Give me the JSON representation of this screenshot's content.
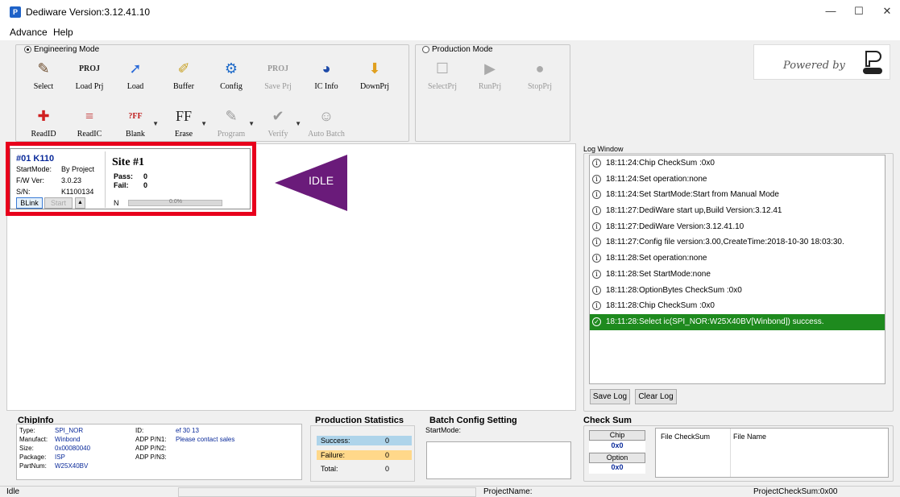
{
  "window": {
    "title": "Dediware Version:3.12.41.10",
    "app_icon": "P",
    "minimize": "—",
    "maximize": "☐",
    "close": "✕"
  },
  "menu": [
    "Advance",
    "Help"
  ],
  "engineering": {
    "label": "Engineering Mode",
    "row1": [
      {
        "label": "Select",
        "icon": "wand-icon",
        "glyph": "✎",
        "color": "#6b4a2a",
        "disabled": false
      },
      {
        "label": "Load Prj",
        "icon": "load-project-icon",
        "glyph": "PROJ",
        "color": "#222",
        "disabled": false
      },
      {
        "label": "Load",
        "icon": "load-icon",
        "glyph": "➚",
        "color": "#2a6ad8",
        "disabled": false
      },
      {
        "label": "Buffer",
        "icon": "buffer-icon",
        "glyph": "✐",
        "color": "#c8a020",
        "disabled": false
      },
      {
        "label": "Config",
        "icon": "gear-icon",
        "glyph": "⚙",
        "color": "#1e6ac8",
        "disabled": false
      },
      {
        "label": "Save Prj",
        "icon": "save-project-icon",
        "glyph": "PROJ",
        "color": "#999",
        "disabled": true
      },
      {
        "label": "IC Info",
        "icon": "ic-info-icon",
        "glyph": "◕",
        "color": "#1e4aa8",
        "disabled": false
      },
      {
        "label": "DownPrj",
        "icon": "download-project-icon",
        "glyph": "⬇",
        "color": "#e0a020",
        "disabled": false
      }
    ],
    "row2": [
      {
        "label": "ReadID",
        "icon": "read-id-icon",
        "glyph": "✚",
        "color": "#d02020",
        "disabled": false,
        "dropdown": false
      },
      {
        "label": "ReadIC",
        "icon": "read-ic-icon",
        "glyph": "≡",
        "color": "#c03030",
        "disabled": false,
        "dropdown": false
      },
      {
        "label": "Blank",
        "icon": "blank-icon",
        "glyph": "?FF",
        "color": "#c02020",
        "disabled": false,
        "dropdown": true
      },
      {
        "label": "Erase",
        "icon": "erase-icon",
        "glyph": "FF",
        "color": "#222",
        "disabled": false,
        "dropdown": true
      },
      {
        "label": "Program",
        "icon": "program-icon",
        "glyph": "✎",
        "color": "#999",
        "disabled": true,
        "dropdown": true
      },
      {
        "label": "Verify",
        "icon": "verify-icon",
        "glyph": "✔",
        "color": "#999",
        "disabled": true,
        "dropdown": true
      },
      {
        "label": "Auto Batch",
        "icon": "auto-batch-icon",
        "glyph": "☺",
        "color": "#999",
        "disabled": true,
        "dropdown": false
      }
    ]
  },
  "production": {
    "label": "Production Mode",
    "buttons": [
      {
        "label": "SelectPrj",
        "icon": "select-project-icon",
        "glyph": "☐"
      },
      {
        "label": "RunPrj",
        "icon": "run-project-icon",
        "glyph": "▶"
      },
      {
        "label": "StopPrj",
        "icon": "stop-project-icon",
        "glyph": "●"
      }
    ]
  },
  "powered_by": "Powered by",
  "site_card": {
    "id": "#01 K110",
    "startmode_label": "StartMode:",
    "startmode": "By Project",
    "fw_label": "F/W Ver:",
    "fw": "3.0.23",
    "sn_label": "S/N:",
    "sn": "K1100134",
    "blink": "BLink",
    "start": "Start",
    "site": "Site #1",
    "pass_label": "Pass:",
    "pass": "0",
    "fail_label": "Fail:",
    "fail": "0",
    "n_label": "N",
    "progress_text": "0.0%",
    "progress": 0,
    "state": "IDLE"
  },
  "log": {
    "title": "Log Window",
    "entries": [
      {
        "text": "18:11:24:Chip CheckSum :0x0",
        "ok": false
      },
      {
        "text": "18:11:24:Set operation:none",
        "ok": false
      },
      {
        "text": "18:11:24:Set StartMode:Start from Manual Mode",
        "ok": false
      },
      {
        "text": "18:11:27:DediWare start up,Build Version:3.12.41",
        "ok": false
      },
      {
        "text": "18:11:27:DediWare Version:3.12.41.10",
        "ok": false
      },
      {
        "text": "18:11:27:Config file version:3.00,CreateTime:2018-10-30 18:03:30.",
        "ok": false
      },
      {
        "text": "18:11:28:Set operation:none",
        "ok": false
      },
      {
        "text": "18:11:28:Set StartMode:none",
        "ok": false
      },
      {
        "text": "18:11:28:OptionBytes CheckSum :0x0",
        "ok": false
      },
      {
        "text": "18:11:28:Chip CheckSum :0x0",
        "ok": false
      },
      {
        "text": "18:11:28:Select ic(SPI_NOR:W25X40BV[Winbond]) success.",
        "ok": true
      }
    ],
    "save": "Save Log",
    "clear": "Clear Log"
  },
  "chipinfo": {
    "title": "ChipInfo",
    "type_label": "Type:",
    "type": "SPI_NOR",
    "manufact_label": "Manufact:",
    "manufact": "Winbond",
    "size_label": "Size:",
    "size": "0x00080040",
    "package_label": "Package:",
    "package": "ISP",
    "partnum_label": "PartNum:",
    "partnum": "W25X40BV",
    "id_label": "ID:",
    "id": "ef 30 13",
    "adp1_label": "ADP P/N1:",
    "adp1": "Please contact sales",
    "adp2_label": "ADP P/N2:",
    "adp2": "",
    "adp3_label": "ADP P/N3:",
    "adp3": ""
  },
  "production_stats": {
    "title": "Production Statistics",
    "success_label": "Success:",
    "success": "0",
    "failure_label": "Failure:",
    "failure": "0",
    "total_label": "Total:",
    "total": "0"
  },
  "batch": {
    "title": "Batch Config Setting",
    "startmode_label": "StartMode:",
    "startmode": ""
  },
  "checksum": {
    "title": "Check Sum",
    "chip_label": "Chip",
    "chip": "0x0",
    "option_label": "Option",
    "option": "0x0",
    "file_checksum": "File CheckSum",
    "file_name": "File Name"
  },
  "status": {
    "left": "Idle",
    "project": "ProjectName:",
    "project_checksum": "ProjectCheckSum:0x00"
  }
}
